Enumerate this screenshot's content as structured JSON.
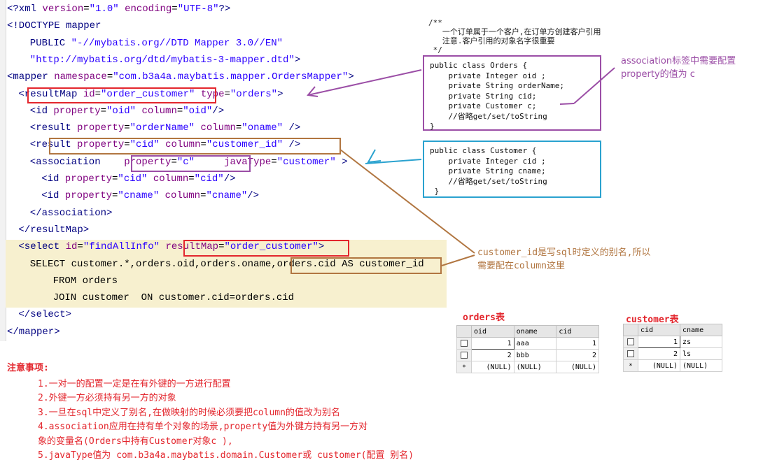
{
  "code_lines": [
    {
      "indent": 0,
      "parts": [
        [
          "tag",
          "<?xml "
        ],
        [
          "attr",
          "version"
        ],
        [
          "kw",
          "="
        ],
        [
          "val",
          "\"1.0\""
        ],
        [
          "kw",
          " "
        ],
        [
          "attr",
          "encoding"
        ],
        [
          "kw",
          "="
        ],
        [
          "val",
          "\"UTF-8\""
        ],
        [
          "tag",
          "?>"
        ]
      ]
    },
    {
      "indent": 0,
      "parts": [
        [
          "tag",
          "<!DOCTYPE mapper"
        ]
      ]
    },
    {
      "indent": 4,
      "parts": [
        [
          "tag",
          "PUBLIC "
        ],
        [
          "val",
          "\"-//mybatis.org//DTD Mapper 3.0//EN\""
        ]
      ]
    },
    {
      "indent": 4,
      "parts": [
        [
          "val",
          "\"http://mybatis.org/dtd/mybatis-3-mapper.dtd\""
        ],
        [
          "tag",
          ">"
        ]
      ]
    },
    {
      "indent": 0,
      "parts": [
        [
          "tag",
          "<mapper "
        ],
        [
          "attr",
          "namespace"
        ],
        [
          "kw",
          "="
        ],
        [
          "val",
          "\"com.b3a4a.maybatis.mapper.OrdersMapper\""
        ],
        [
          "tag",
          ">"
        ]
      ]
    },
    {
      "indent": 2,
      "parts": [
        [
          "tag",
          "<resultMap "
        ],
        [
          "attr",
          "id"
        ],
        [
          "kw",
          "="
        ],
        [
          "val",
          "\"order_customer\""
        ],
        [
          "kw",
          " "
        ],
        [
          "attr",
          "type"
        ],
        [
          "kw",
          "="
        ],
        [
          "val",
          "\"orders\""
        ],
        [
          "tag",
          ">"
        ]
      ]
    },
    {
      "indent": 4,
      "parts": [
        [
          "tag",
          "<id "
        ],
        [
          "attr",
          "property"
        ],
        [
          "kw",
          "="
        ],
        [
          "val",
          "\"oid\""
        ],
        [
          "kw",
          " "
        ],
        [
          "attr",
          "column"
        ],
        [
          "kw",
          "="
        ],
        [
          "val",
          "\"oid\""
        ],
        [
          "tag",
          "/>"
        ]
      ]
    },
    {
      "indent": 4,
      "parts": [
        [
          "tag",
          "<result "
        ],
        [
          "attr",
          "property"
        ],
        [
          "kw",
          "="
        ],
        [
          "val",
          "\"orderName\""
        ],
        [
          "kw",
          " "
        ],
        [
          "attr",
          "column"
        ],
        [
          "kw",
          "="
        ],
        [
          "val",
          "\"oname\""
        ],
        [
          "tag",
          " />"
        ]
      ]
    },
    {
      "indent": 4,
      "parts": [
        [
          "tag",
          "<result "
        ],
        [
          "attr",
          "property"
        ],
        [
          "kw",
          "="
        ],
        [
          "val",
          "\"cid\""
        ],
        [
          "kw",
          " "
        ],
        [
          "attr",
          "column"
        ],
        [
          "kw",
          "="
        ],
        [
          "val",
          "\"customer_id\""
        ],
        [
          "tag",
          " />"
        ]
      ]
    },
    {
      "indent": 4,
      "parts": [
        [
          "tag",
          "<association    "
        ],
        [
          "attr",
          "property"
        ],
        [
          "kw",
          "="
        ],
        [
          "val",
          "\"c\""
        ],
        [
          "kw",
          "     "
        ],
        [
          "attr",
          "javaType"
        ],
        [
          "kw",
          "="
        ],
        [
          "val",
          "\"customer\""
        ],
        [
          "tag",
          " >"
        ]
      ]
    },
    {
      "indent": 6,
      "parts": [
        [
          "tag",
          "<id "
        ],
        [
          "attr",
          "property"
        ],
        [
          "kw",
          "="
        ],
        [
          "val",
          "\"cid\""
        ],
        [
          "kw",
          " "
        ],
        [
          "attr",
          "column"
        ],
        [
          "kw",
          "="
        ],
        [
          "val",
          "\"cid\""
        ],
        [
          "tag",
          "/>"
        ]
      ]
    },
    {
      "indent": 6,
      "parts": [
        [
          "tag",
          "<id "
        ],
        [
          "attr",
          "property"
        ],
        [
          "kw",
          "="
        ],
        [
          "val",
          "\"cname\""
        ],
        [
          "kw",
          " "
        ],
        [
          "attr",
          "column"
        ],
        [
          "kw",
          "="
        ],
        [
          "val",
          "\"cname\""
        ],
        [
          "tag",
          "/>"
        ]
      ]
    },
    {
      "indent": 4,
      "parts": [
        [
          "tag",
          "</association>"
        ]
      ]
    },
    {
      "indent": 2,
      "parts": [
        [
          "tag",
          "</resultMap>"
        ]
      ]
    },
    {
      "indent": 2,
      "parts": [
        [
          "tag",
          "<select "
        ],
        [
          "attr",
          "id"
        ],
        [
          "kw",
          "="
        ],
        [
          "val",
          "\"findAllInfo\""
        ],
        [
          "kw",
          " "
        ],
        [
          "attr",
          "resultMap"
        ],
        [
          "kw",
          "="
        ],
        [
          "val",
          "\"order_customer\""
        ],
        [
          "tag",
          ">"
        ]
      ]
    },
    {
      "indent": 4,
      "parts": [
        [
          "sql",
          "SELECT customer.*,orders.oid,orders.oname,orders.cid AS customer_id"
        ]
      ]
    },
    {
      "indent": 8,
      "parts": [
        [
          "sql",
          "FROM orders"
        ]
      ]
    },
    {
      "indent": 8,
      "parts": [
        [
          "sql",
          "JOIN customer  ON customer.cid=orders.cid"
        ]
      ]
    },
    {
      "indent": 2,
      "parts": [
        [
          "tag",
          "</select>"
        ]
      ]
    },
    {
      "indent": 0,
      "parts": [
        [
          "tag",
          "</mapper>"
        ]
      ]
    }
  ],
  "java_comment": "/**\n   一个订单属于一个客户,在订单方创建客户引用\n   注意.客户引用的对象名字很重要\n */",
  "orders_class": "public class Orders {\n    private Integer oid ;\n    private String orderName;\n    private String cid;\n    private Customer c;\n    //省略get/set/toString\n}",
  "customer_class": "public class Customer {\n    private Integer cid ;\n    private String cname;\n    //省略get/set/toString\n }",
  "note_association": "association标签中需要配置property的值为 c",
  "note_customer_id": "customer_id是写sql时定义的别名,所以需要配在column这里",
  "orders_table": {
    "title": "orders表",
    "headers": [
      "oid",
      "oname",
      "cid"
    ],
    "rows": [
      [
        "1",
        "aaa",
        "1"
      ],
      [
        "2",
        "bbb",
        "2"
      ],
      [
        "(NULL)",
        "(NULL)",
        "(NULL)"
      ]
    ]
  },
  "customer_table": {
    "title": "customer表",
    "headers": [
      "cid",
      "cname"
    ],
    "rows": [
      [
        "1",
        "zs"
      ],
      [
        "2",
        "ls"
      ],
      [
        "(NULL)",
        "(NULL)"
      ]
    ]
  },
  "notes": {
    "head": "注意事项:",
    "items": [
      "1.一对一的配置一定是在有外键的一方进行配置",
      "2.外键一方必须持有另一方的对象",
      "3.一旦在sql中定义了别名,在做映射的时候必须要把column的值改为别名",
      "4.association应用在持有单个对象的场景,property值为外键方持有另一方对",
      "象的变量名(Orders中持有Customer对象c ),",
      "5.javaType值为 com.b3a4a.maybatis.domain.Customer或 customer(配置 别名)"
    ]
  },
  "colors": {
    "red": "#e3262d",
    "brown": "#b17641",
    "purple": "#9b4ea6",
    "blue": "#2aa2cf"
  }
}
